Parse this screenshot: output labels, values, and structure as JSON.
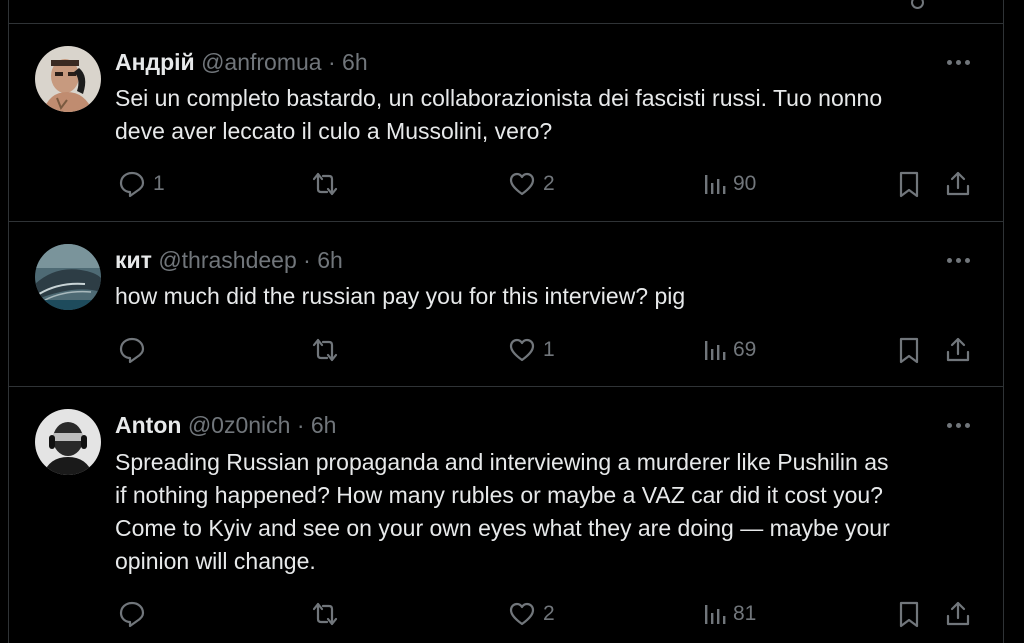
{
  "colors": {
    "background": "#000000",
    "divider": "#2f3336",
    "primary_text": "#e7e9ea",
    "secondary_text": "#71767b"
  },
  "tweets": [
    {
      "name": "Андрій",
      "handle": "@anfromua",
      "separator": "·",
      "time": "6h",
      "text": "Sei un completo bastardo, un collaborazionista dei fascisti russi. Tuo nonno\ndeve aver leccato il culo a Mussolini, vero?",
      "replies": "1",
      "retweets": "",
      "likes": "2",
      "views": "90",
      "avatar_icon": "person-with-phone-avatar"
    },
    {
      "name": "кит",
      "handle": "@thrashdeep",
      "separator": "·",
      "time": "6h",
      "text": "how much did the russian pay you for this interview? pig",
      "replies": "",
      "retweets": "",
      "likes": "1",
      "views": "69",
      "avatar_icon": "whale-avatar"
    },
    {
      "name": "Anton",
      "handle": "@0z0nich",
      "separator": "·",
      "time": "6h",
      "text": "Spreading Russian propaganda and interviewing a murderer like Pushilin as\nif nothing happened? How many rubles or maybe a VAZ car did it cost you?\nCome to Kyiv and see on your own eyes what they are doing — maybe your\nopinion will change.",
      "replies": "",
      "retweets": "",
      "likes": "2",
      "views": "81",
      "avatar_icon": "person-with-headset-avatar"
    }
  ]
}
